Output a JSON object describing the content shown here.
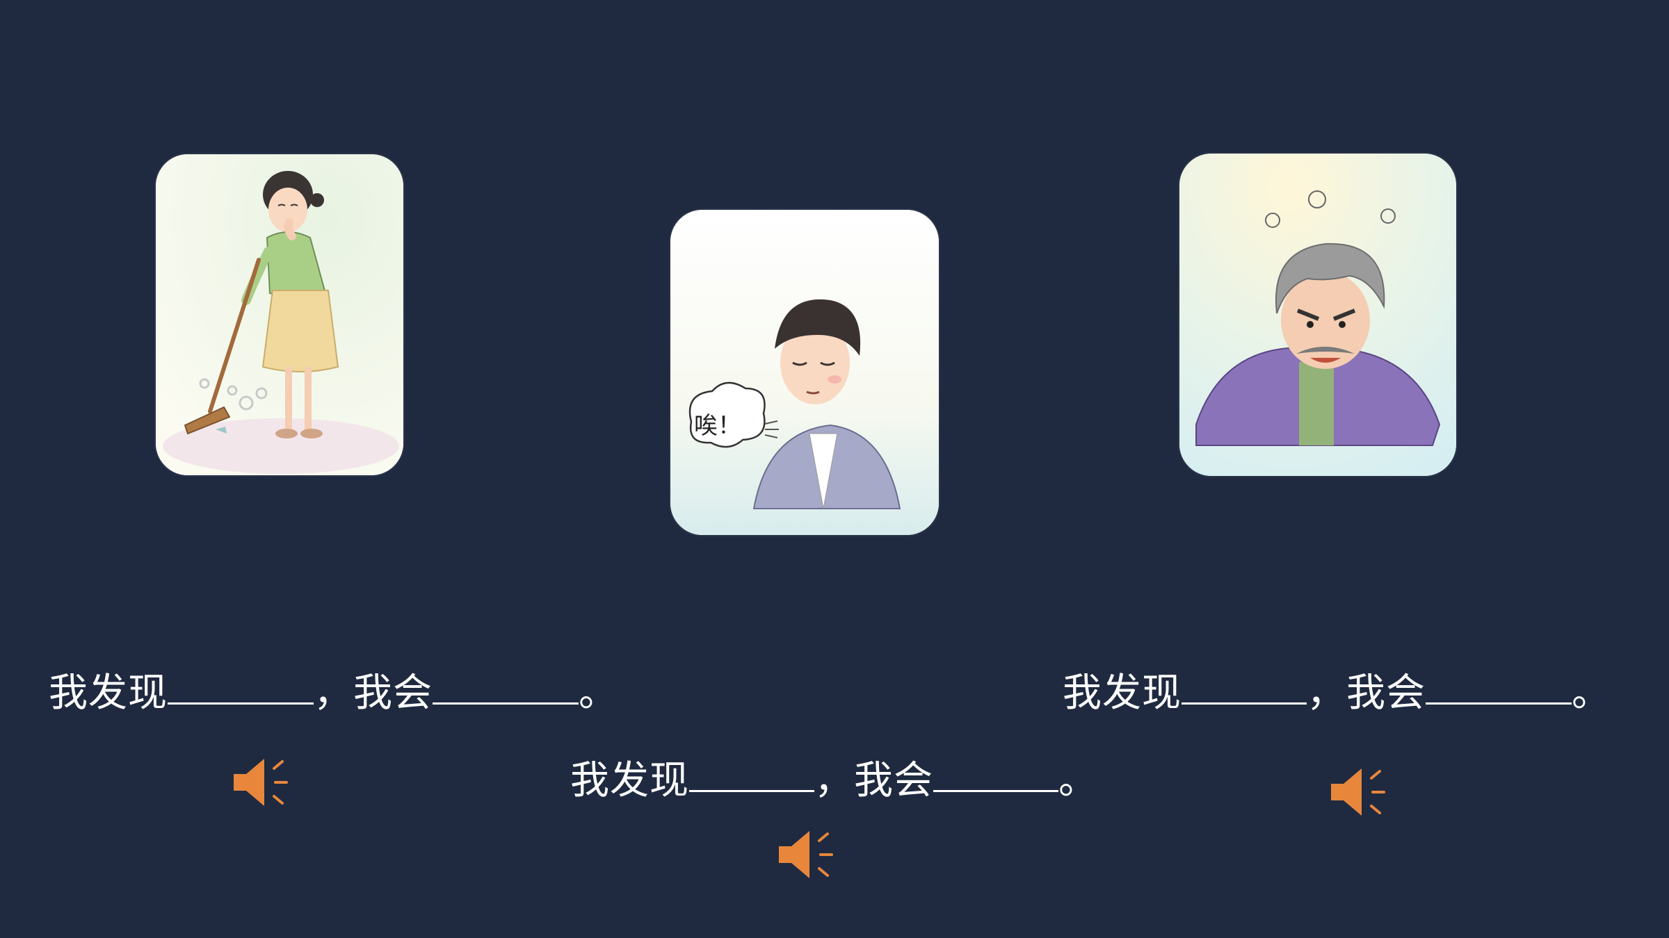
{
  "colors": {
    "background": "#1f2a40",
    "text": "#ffffff",
    "speaker_icon": "#e8873c"
  },
  "scenes": [
    {
      "id": "woman-sweeping",
      "image_icon": "woman-sweeping-dust-illustration",
      "sentence": {
        "prefix": "我发现",
        "comma": "，",
        "middle": "我会",
        "period": "。"
      },
      "audio_icon": "speaker-icon"
    },
    {
      "id": "man-sighing",
      "image_icon": "man-sighing-illustration",
      "bubble_text": "唉！",
      "sentence": {
        "prefix": "我发现",
        "comma": "，",
        "middle": "我会",
        "period": "。"
      },
      "audio_icon": "speaker-icon"
    },
    {
      "id": "old-man-angry",
      "image_icon": "angry-grandfather-illustration",
      "sentence": {
        "prefix": "我发现",
        "comma": "，",
        "middle": "我会",
        "period": "。"
      },
      "audio_icon": "speaker-icon"
    }
  ]
}
